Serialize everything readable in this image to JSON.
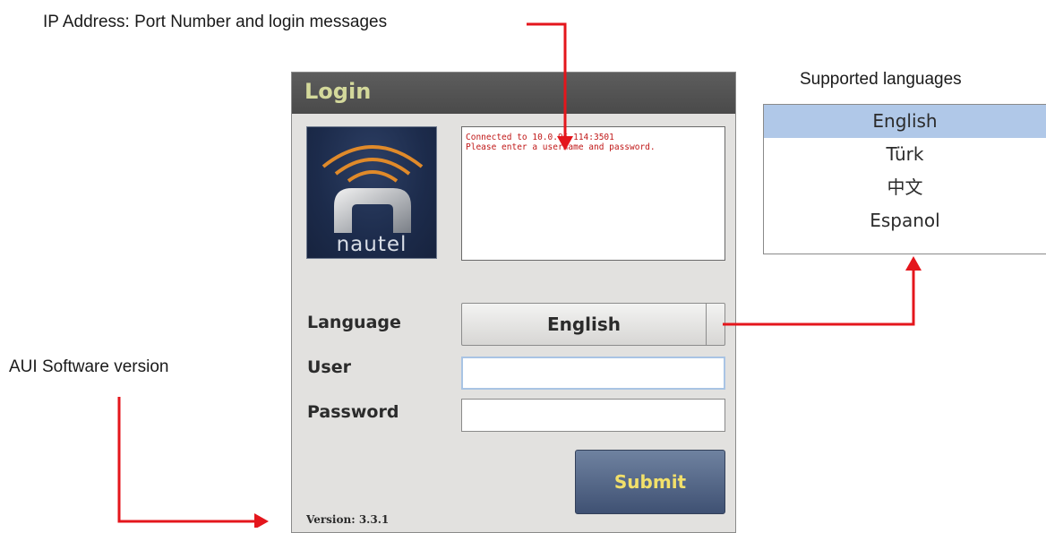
{
  "annotations": {
    "ip_address": "IP Address: Port Number and login messages",
    "supported_languages": "Supported languages",
    "aui_software_version": "AUI Software version"
  },
  "login": {
    "title": "Login",
    "logo_text": "nautel",
    "messages": [
      "Connected to 10.0.96.114:3501",
      "Please enter a username and password."
    ],
    "language_label": "Language",
    "language_value": "English",
    "user_label": "User",
    "user_value": "",
    "password_label": "Password",
    "password_value": "",
    "submit_label": "Submit",
    "version": "Version: 3.3.1"
  },
  "languages": [
    "English",
    "Türk",
    "中文",
    "Espanol"
  ],
  "selected_language": "English",
  "colors": {
    "arrow": "#e4161c",
    "title_text": "#d4d99b",
    "message_text": "#c01818",
    "submit_text": "#f2e06a",
    "selected_row": "#b0c8e8"
  }
}
